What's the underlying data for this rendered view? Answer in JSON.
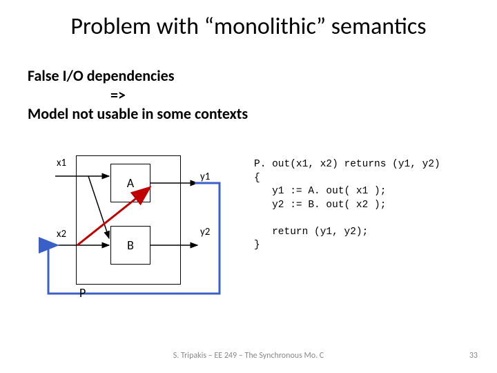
{
  "title": "Problem with “monolithic” semantics",
  "sub": {
    "l1": "False I/O dependencies",
    "l2": "=>",
    "l3": "Model not usable in some contexts"
  },
  "diagram": {
    "x1": "x1",
    "x2": "x2",
    "y1": "y1",
    "y2": "y2",
    "blockA": "A",
    "blockB": "B",
    "P": "P"
  },
  "code": {
    "l1": "P. out(x1, x2) returns (y1, y2)",
    "l2": "{",
    "l3": "   y1 := A. out( x1 );",
    "l4": "   y2 := B. out( x2 );",
    "l5": "",
    "l6": "   return (y1, y2);",
    "l7": "}"
  },
  "footer": "S. Tripakis – EE 249 – The Synchronous Mo. C",
  "page": "33"
}
